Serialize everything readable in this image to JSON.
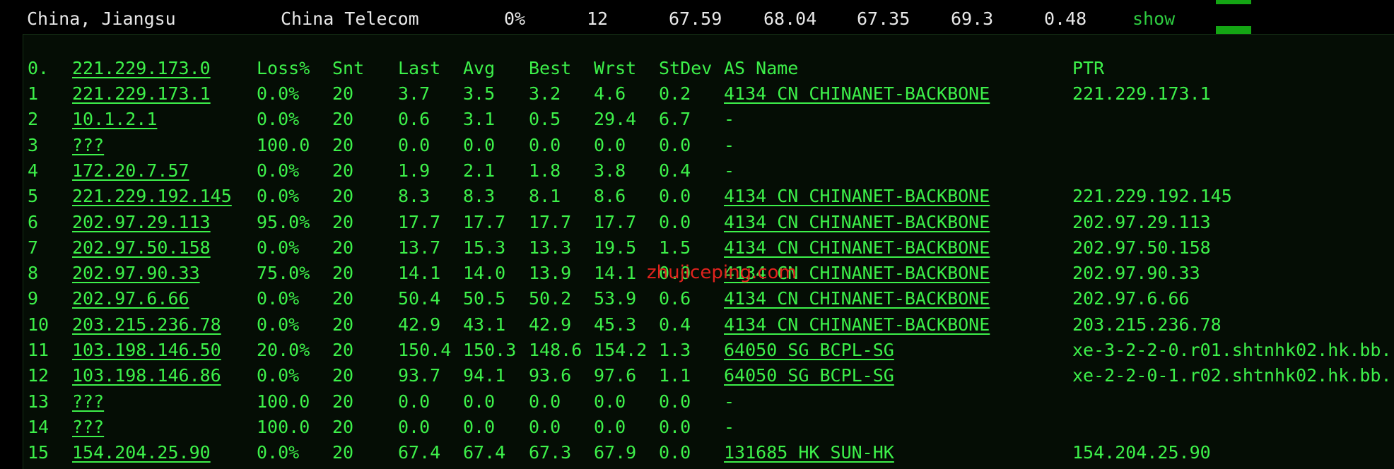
{
  "summary": {
    "location": "China, Jiangsu",
    "isp": "China Telecom",
    "loss": "0%",
    "sent": "12",
    "last": "67.59",
    "avg": "68.04",
    "best": "67.35",
    "worst": "69.3",
    "stdev": "0.48",
    "action_label": "show",
    "indicator_color": "#14a514"
  },
  "header": {
    "hop": "0.",
    "host": "221.229.173.0",
    "loss": "Loss%",
    "snt": "Snt",
    "last": "Last",
    "avg": "Avg",
    "best": "Best",
    "wrst": "Wrst",
    "stdev": "StDev",
    "as_name": "AS Name",
    "ptr": "PTR"
  },
  "hops": [
    {
      "hop": "1",
      "host": "221.229.173.1",
      "loss": "0.0%",
      "snt": "20",
      "last": "3.7",
      "avg": "3.5",
      "best": "3.2",
      "wrst": "4.6",
      "stdev": "0.2",
      "as": "4134  CN CHINANET-BACKBONE",
      "ptr": "221.229.173.1"
    },
    {
      "hop": "2",
      "host": "10.1.2.1",
      "loss": "0.0%",
      "snt": "20",
      "last": "0.6",
      "avg": "3.1",
      "best": "0.5",
      "wrst": "29.4",
      "stdev": "6.7",
      "as": "-",
      "ptr": ""
    },
    {
      "hop": "3",
      "host": "???",
      "loss": "100.0",
      "snt": "20",
      "last": "0.0",
      "avg": "0.0",
      "best": "0.0",
      "wrst": "0.0",
      "stdev": "0.0",
      "as": "-",
      "ptr": ""
    },
    {
      "hop": "4",
      "host": "172.20.7.57",
      "loss": "0.0%",
      "snt": "20",
      "last": "1.9",
      "avg": "2.1",
      "best": "1.8",
      "wrst": "3.8",
      "stdev": "0.4",
      "as": "-",
      "ptr": ""
    },
    {
      "hop": "5",
      "host": "221.229.192.145",
      "loss": "0.0%",
      "snt": "20",
      "last": "8.3",
      "avg": "8.3",
      "best": "8.1",
      "wrst": "8.6",
      "stdev": "0.0",
      "as": "4134  CN CHINANET-BACKBONE",
      "ptr": "221.229.192.145"
    },
    {
      "hop": "6",
      "host": "202.97.29.113",
      "loss": "95.0%",
      "snt": "20",
      "last": "17.7",
      "avg": "17.7",
      "best": "17.7",
      "wrst": "17.7",
      "stdev": "0.0",
      "as": "4134  CN CHINANET-BACKBONE",
      "ptr": "202.97.29.113"
    },
    {
      "hop": "7",
      "host": "202.97.50.158",
      "loss": "0.0%",
      "snt": "20",
      "last": "13.7",
      "avg": "15.3",
      "best": "13.3",
      "wrst": "19.5",
      "stdev": "1.5",
      "as": "4134  CN CHINANET-BACKBONE",
      "ptr": "202.97.50.158"
    },
    {
      "hop": "8",
      "host": "202.97.90.33",
      "loss": "75.0%",
      "snt": "20",
      "last": "14.1",
      "avg": "14.0",
      "best": "13.9",
      "wrst": "14.1",
      "stdev": "0.0",
      "as": "4134  CN CHINANET-BACKBONE",
      "ptr": "202.97.90.33"
    },
    {
      "hop": "9",
      "host": "202.97.6.66",
      "loss": "0.0%",
      "snt": "20",
      "last": "50.4",
      "avg": "50.5",
      "best": "50.2",
      "wrst": "53.9",
      "stdev": "0.6",
      "as": "4134  CN CHINANET-BACKBONE",
      "ptr": "202.97.6.66"
    },
    {
      "hop": "10",
      "host": "203.215.236.78",
      "loss": "0.0%",
      "snt": "20",
      "last": "42.9",
      "avg": "43.1",
      "best": "42.9",
      "wrst": "45.3",
      "stdev": "0.4",
      "as": "4134  CN CHINANET-BACKBONE",
      "ptr": "203.215.236.78"
    },
    {
      "hop": "11",
      "host": "103.198.146.50",
      "loss": "20.0%",
      "snt": "20",
      "last": "150.4",
      "avg": "150.3",
      "best": "148.6",
      "wrst": "154.2",
      "stdev": "1.3",
      "as": "64050 SG BCPL-SG",
      "ptr": "xe-3-2-2-0.r01.shtnhk02.hk.bb."
    },
    {
      "hop": "12",
      "host": "103.198.146.86",
      "loss": "0.0%",
      "snt": "20",
      "last": "93.7",
      "avg": "94.1",
      "best": "93.6",
      "wrst": "97.6",
      "stdev": "1.1",
      "as": "64050 SG BCPL-SG",
      "ptr": "xe-2-2-0-1.r02.shtnhk02.hk.bb."
    },
    {
      "hop": "13",
      "host": "???",
      "loss": "100.0",
      "snt": "20",
      "last": "0.0",
      "avg": "0.0",
      "best": "0.0",
      "wrst": "0.0",
      "stdev": "0.0",
      "as": "-",
      "ptr": ""
    },
    {
      "hop": "14",
      "host": "???",
      "loss": "100.0",
      "snt": "20",
      "last": "0.0",
      "avg": "0.0",
      "best": "0.0",
      "wrst": "0.0",
      "stdev": "0.0",
      "as": "-",
      "ptr": ""
    },
    {
      "hop": "15",
      "host": "154.204.25.90",
      "loss": "0.0%",
      "snt": "20",
      "last": "67.4",
      "avg": "67.4",
      "best": "67.3",
      "wrst": "67.9",
      "stdev": "0.0",
      "as": "131685 HK SUN-HK",
      "ptr": "154.204.25.90"
    }
  ],
  "watermark": "zhujiceping.com"
}
